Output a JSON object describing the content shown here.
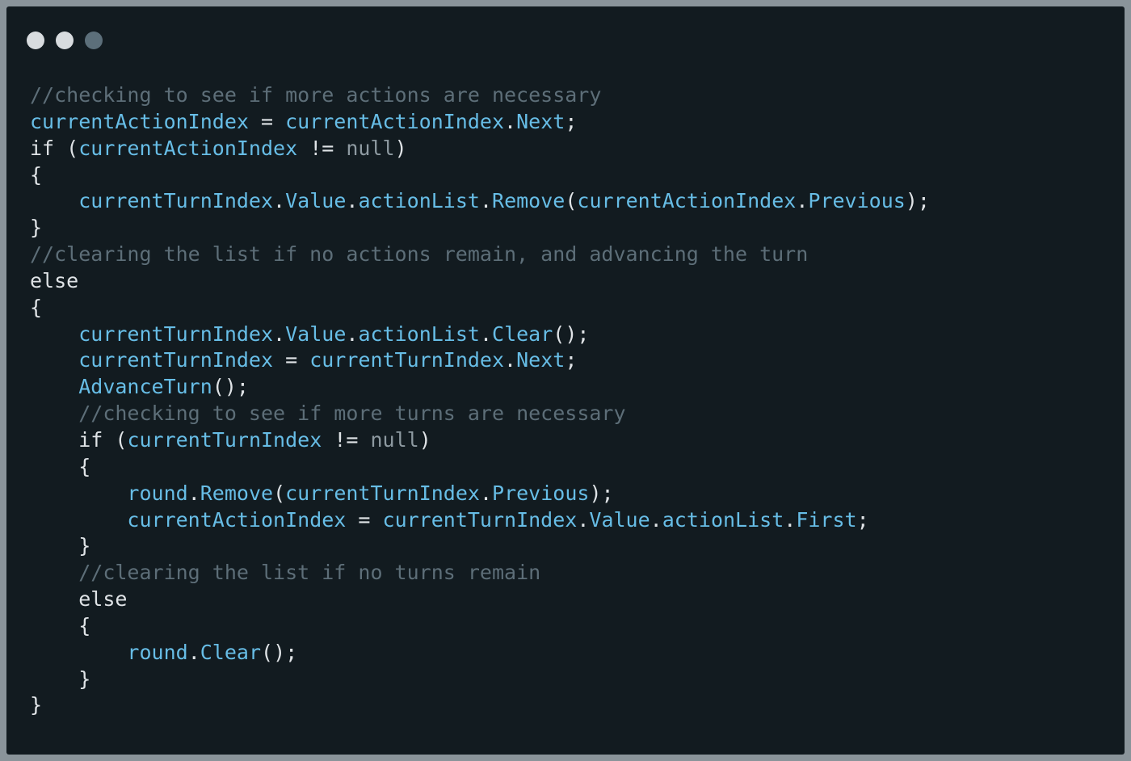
{
  "window": {
    "buttons": [
      {
        "name": "close",
        "color": "#d8dcdf"
      },
      {
        "name": "minimize",
        "color": "#d8dcdf"
      },
      {
        "name": "maximize",
        "color": "#5c6f7a"
      }
    ]
  },
  "colors": {
    "background": "#121b20",
    "comment": "#5d6e78",
    "identifier": "#67bde6",
    "keyword": "#dfe3e6",
    "null": "#8e9aa1"
  },
  "code": {
    "lines": [
      [
        {
          "t": "comment",
          "v": "//checking to see if more actions are necessary"
        }
      ],
      [
        {
          "t": "ident",
          "v": "currentActionIndex"
        },
        {
          "t": "punct",
          "v": " = "
        },
        {
          "t": "ident",
          "v": "currentActionIndex"
        },
        {
          "t": "punct",
          "v": "."
        },
        {
          "t": "ident",
          "v": "Next"
        },
        {
          "t": "punct",
          "v": ";"
        }
      ],
      [
        {
          "t": "keyword",
          "v": "if"
        },
        {
          "t": "punct",
          "v": " ("
        },
        {
          "t": "ident",
          "v": "currentActionIndex"
        },
        {
          "t": "punct",
          "v": " != "
        },
        {
          "t": "null",
          "v": "null"
        },
        {
          "t": "punct",
          "v": ")"
        }
      ],
      [
        {
          "t": "punct",
          "v": "{"
        }
      ],
      [
        {
          "t": "space",
          "v": "    "
        },
        {
          "t": "ident",
          "v": "currentTurnIndex"
        },
        {
          "t": "punct",
          "v": "."
        },
        {
          "t": "ident",
          "v": "Value"
        },
        {
          "t": "punct",
          "v": "."
        },
        {
          "t": "ident",
          "v": "actionList"
        },
        {
          "t": "punct",
          "v": "."
        },
        {
          "t": "ident",
          "v": "Remove"
        },
        {
          "t": "punct",
          "v": "("
        },
        {
          "t": "ident",
          "v": "currentActionIndex"
        },
        {
          "t": "punct",
          "v": "."
        },
        {
          "t": "ident",
          "v": "Previous"
        },
        {
          "t": "punct",
          "v": ");"
        }
      ],
      [
        {
          "t": "punct",
          "v": "}"
        }
      ],
      [
        {
          "t": "comment",
          "v": "//clearing the list if no actions remain, and advancing the turn"
        }
      ],
      [
        {
          "t": "keyword",
          "v": "else"
        }
      ],
      [
        {
          "t": "punct",
          "v": "{"
        }
      ],
      [
        {
          "t": "space",
          "v": "    "
        },
        {
          "t": "ident",
          "v": "currentTurnIndex"
        },
        {
          "t": "punct",
          "v": "."
        },
        {
          "t": "ident",
          "v": "Value"
        },
        {
          "t": "punct",
          "v": "."
        },
        {
          "t": "ident",
          "v": "actionList"
        },
        {
          "t": "punct",
          "v": "."
        },
        {
          "t": "ident",
          "v": "Clear"
        },
        {
          "t": "punct",
          "v": "();"
        }
      ],
      [
        {
          "t": "space",
          "v": "    "
        },
        {
          "t": "ident",
          "v": "currentTurnIndex"
        },
        {
          "t": "punct",
          "v": " = "
        },
        {
          "t": "ident",
          "v": "currentTurnIndex"
        },
        {
          "t": "punct",
          "v": "."
        },
        {
          "t": "ident",
          "v": "Next"
        },
        {
          "t": "punct",
          "v": ";"
        }
      ],
      [
        {
          "t": "space",
          "v": "    "
        },
        {
          "t": "ident",
          "v": "AdvanceTurn"
        },
        {
          "t": "punct",
          "v": "();"
        }
      ],
      [
        {
          "t": "space",
          "v": "    "
        },
        {
          "t": "comment",
          "v": "//checking to see if more turns are necessary"
        }
      ],
      [
        {
          "t": "space",
          "v": "    "
        },
        {
          "t": "keyword",
          "v": "if"
        },
        {
          "t": "punct",
          "v": " ("
        },
        {
          "t": "ident",
          "v": "currentTurnIndex"
        },
        {
          "t": "punct",
          "v": " != "
        },
        {
          "t": "null",
          "v": "null"
        },
        {
          "t": "punct",
          "v": ")"
        }
      ],
      [
        {
          "t": "space",
          "v": "    "
        },
        {
          "t": "punct",
          "v": "{"
        }
      ],
      [
        {
          "t": "space",
          "v": "        "
        },
        {
          "t": "ident",
          "v": "round"
        },
        {
          "t": "punct",
          "v": "."
        },
        {
          "t": "ident",
          "v": "Remove"
        },
        {
          "t": "punct",
          "v": "("
        },
        {
          "t": "ident",
          "v": "currentTurnIndex"
        },
        {
          "t": "punct",
          "v": "."
        },
        {
          "t": "ident",
          "v": "Previous"
        },
        {
          "t": "punct",
          "v": ");"
        }
      ],
      [
        {
          "t": "space",
          "v": "        "
        },
        {
          "t": "ident",
          "v": "currentActionIndex"
        },
        {
          "t": "punct",
          "v": " = "
        },
        {
          "t": "ident",
          "v": "currentTurnIndex"
        },
        {
          "t": "punct",
          "v": "."
        },
        {
          "t": "ident",
          "v": "Value"
        },
        {
          "t": "punct",
          "v": "."
        },
        {
          "t": "ident",
          "v": "actionList"
        },
        {
          "t": "punct",
          "v": "."
        },
        {
          "t": "ident",
          "v": "First"
        },
        {
          "t": "punct",
          "v": ";"
        }
      ],
      [
        {
          "t": "space",
          "v": "    "
        },
        {
          "t": "punct",
          "v": "}"
        }
      ],
      [
        {
          "t": "space",
          "v": "    "
        },
        {
          "t": "comment",
          "v": "//clearing the list if no turns remain"
        }
      ],
      [
        {
          "t": "space",
          "v": "    "
        },
        {
          "t": "keyword",
          "v": "else"
        }
      ],
      [
        {
          "t": "space",
          "v": "    "
        },
        {
          "t": "punct",
          "v": "{"
        }
      ],
      [
        {
          "t": "space",
          "v": "        "
        },
        {
          "t": "ident",
          "v": "round"
        },
        {
          "t": "punct",
          "v": "."
        },
        {
          "t": "ident",
          "v": "Clear"
        },
        {
          "t": "punct",
          "v": "();"
        }
      ],
      [
        {
          "t": "space",
          "v": "    "
        },
        {
          "t": "punct",
          "v": "}"
        }
      ],
      [
        {
          "t": "punct",
          "v": "}"
        }
      ]
    ]
  }
}
